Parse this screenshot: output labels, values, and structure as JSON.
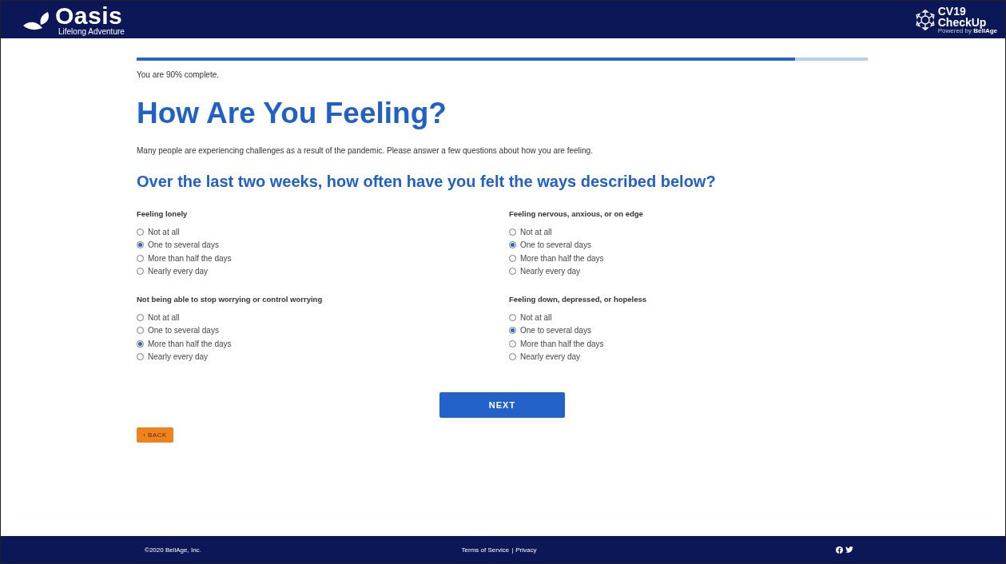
{
  "header": {
    "logo": {
      "name": "Oasis",
      "tagline": "Lifelong Adventure"
    },
    "partner_logo": {
      "line_1": "CV19",
      "line_2": "CheckUp",
      "powered_prefix": "Powered by",
      "powered_brand": "BellAge"
    }
  },
  "progress": {
    "level": 0.9,
    "text": "You are 90% complete."
  },
  "title": "How Are You Feeling?",
  "intro": "Many people are experiencing challenges as a result of the pandemic. Please answer a few questions about how you are feeling.",
  "subheading": "Over the last two weeks, how often have you felt the ways described below?",
  "questions": [
    {
      "label": "Feeling lonely",
      "options": [
        {
          "label": "Not at all",
          "selected": false
        },
        {
          "label": "One to several days",
          "selected": true
        },
        {
          "label": "More than half the days",
          "selected": false
        },
        {
          "label": "Nearly every day",
          "selected": false
        }
      ]
    },
    {
      "label": "Feeling nervous, anxious, or on edge",
      "options": [
        {
          "label": "Not at all",
          "selected": false
        },
        {
          "label": "One to several days",
          "selected": true
        },
        {
          "label": "More than half the days",
          "selected": false
        },
        {
          "label": "Nearly every day",
          "selected": false
        }
      ]
    },
    {
      "label": "Not being able to stop worrying or control worrying",
      "options": [
        {
          "label": "Not at all",
          "selected": false
        },
        {
          "label": "One to several days",
          "selected": false
        },
        {
          "label": "More than half the days",
          "selected": true
        },
        {
          "label": "Nearly every day",
          "selected": false
        }
      ]
    },
    {
      "label": "Feeling down, depressed, or hopeless",
      "options": [
        {
          "label": "Not at all",
          "selected": false
        },
        {
          "label": "One to several days",
          "selected": true
        },
        {
          "label": "More than half the days",
          "selected": false
        },
        {
          "label": "Nearly every day",
          "selected": false
        }
      ]
    }
  ],
  "next_button": "NEXT",
  "back_button": "‹ BACK",
  "footer": {
    "copyright": "©2020 BellAge, Inc.",
    "links": [
      "Terms of Service",
      "Privacy"
    ],
    "separator": "|"
  }
}
